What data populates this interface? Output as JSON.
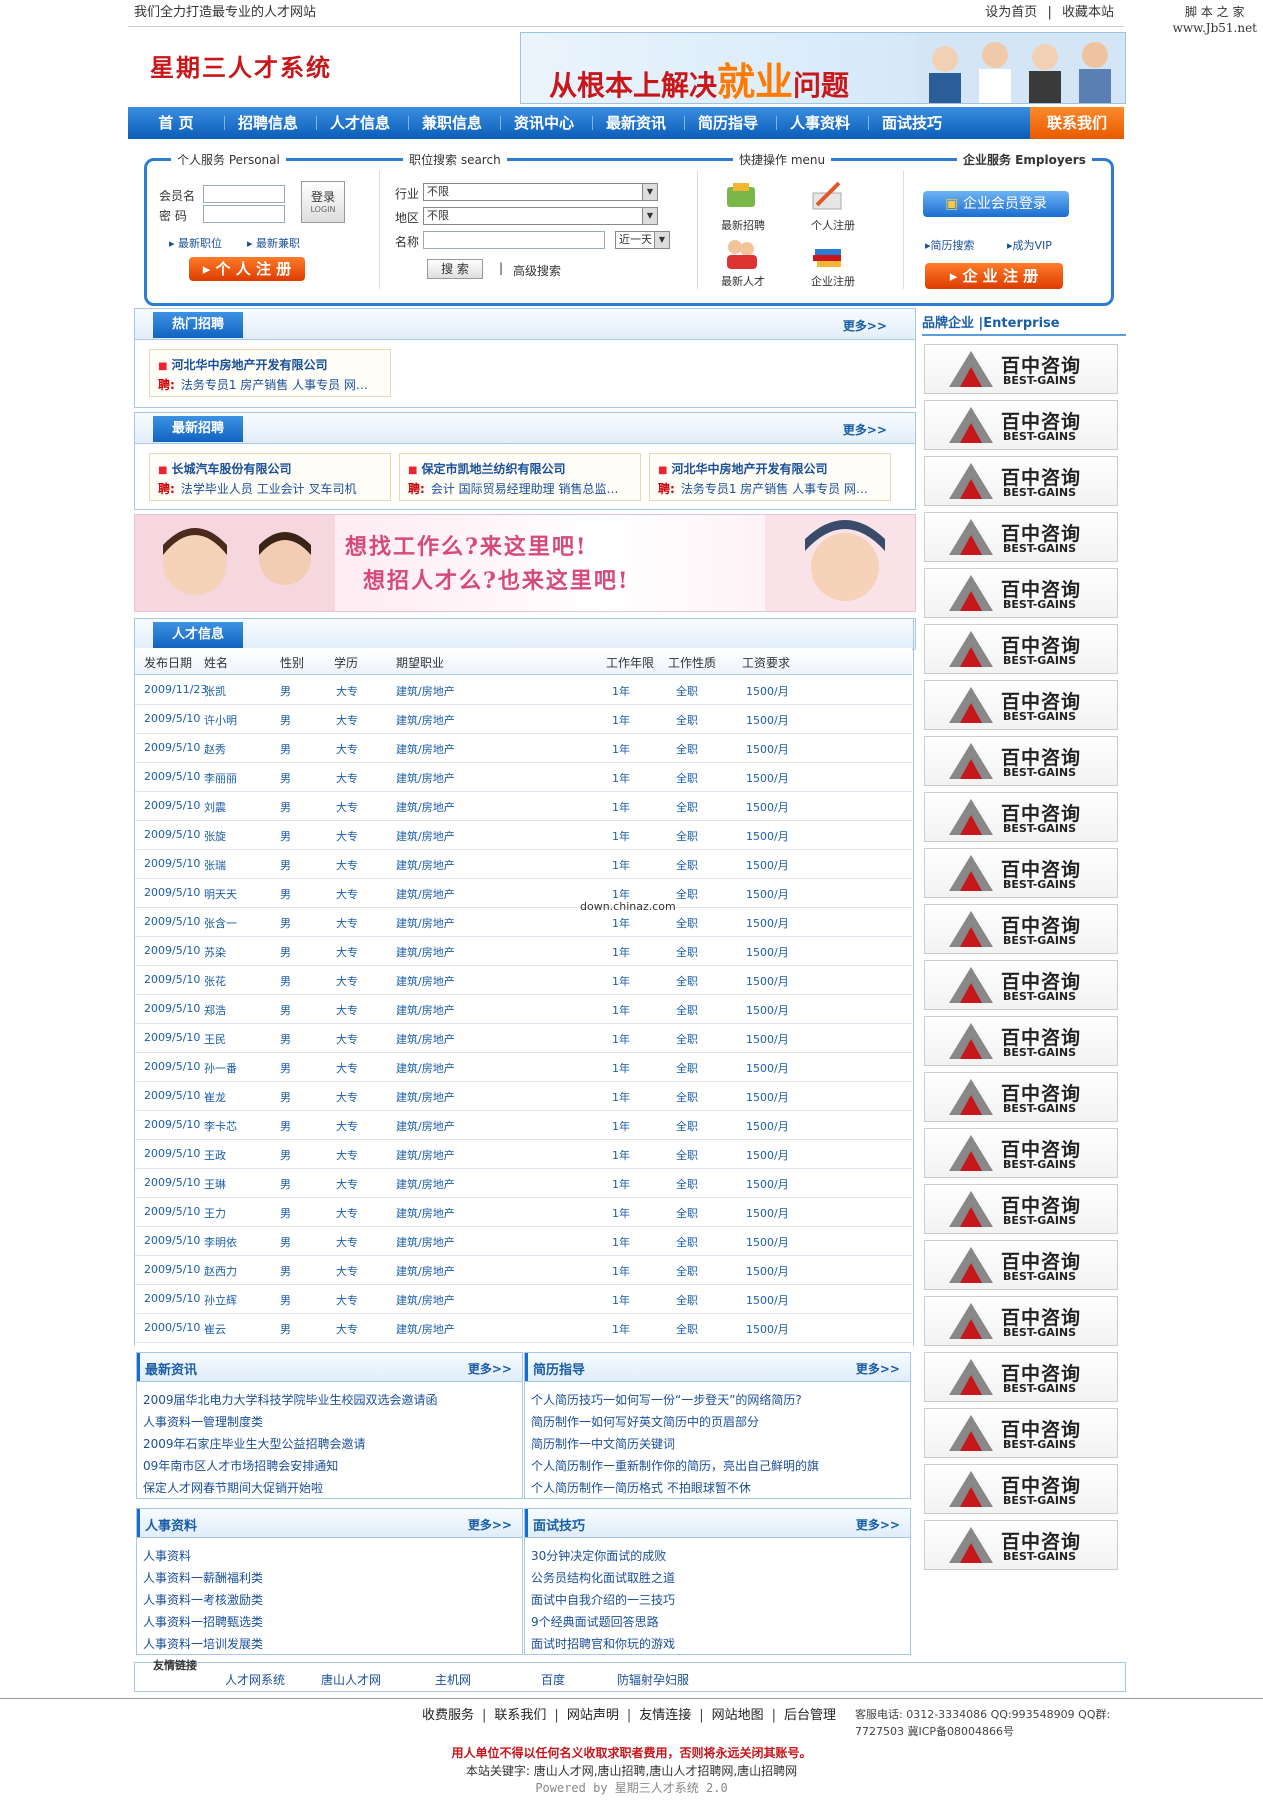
{
  "topbar": {
    "slogan": "我们全力打造最专业的人才网站",
    "set_home": "设为首页",
    "sep": "|",
    "bookmark": "收藏本站"
  },
  "watermark": {
    "line1": "脚 本 之 家",
    "line2": "www.Jb51.net"
  },
  "header": {
    "logo": "星期三人才系统",
    "banner_text": "从根本上解决",
    "banner_big": "就业",
    "banner_tail": "问题"
  },
  "nav": {
    "items": [
      "首 页",
      "招聘信息",
      "人才信息",
      "兼职信息",
      "资讯中心",
      "最新资讯",
      "简历指导",
      "人事资料",
      "面试技巧"
    ],
    "contact": "联系我们"
  },
  "personal": {
    "title": "个人服务 Personal",
    "member_label": "会员名",
    "password_label": "密 码",
    "login_btn": "登录",
    "login_sub": "LOGIN",
    "latest_jobs": "最新职位",
    "latest_part": "最新兼职",
    "register": "个 人 注 册"
  },
  "search": {
    "title": "职位搜索 search",
    "industry_label": "行业",
    "industry_value": "不限",
    "region_label": "地区",
    "region_value": "不限",
    "name_label": "名称",
    "time_value": "近一天",
    "search_btn": "搜 索",
    "sep": "|",
    "advanced": "高级搜索"
  },
  "quick": {
    "title": "快捷操作 menu",
    "items": [
      "最新招聘",
      "个人注册",
      "最新人才",
      "企业注册"
    ]
  },
  "employer": {
    "title": "企业服务 Employers",
    "login": "企业会员登录",
    "resume_search": "简历搜索",
    "vip": "成为VIP",
    "register": "企 业 注 册"
  },
  "hot": {
    "title": "热门招聘",
    "more": "更多>>",
    "cards": [
      {
        "company": "河北华中房地产开发有限公司",
        "tag": "聘:",
        "jobs": "法务专员1 房产销售 人事专员 网…"
      }
    ]
  },
  "latest": {
    "title": "最新招聘",
    "more": "更多>>",
    "cards": [
      {
        "company": "长城汽车股份有限公司",
        "tag": "聘:",
        "jobs": "法学毕业人员 工业会计 叉车司机"
      },
      {
        "company": "保定市凯地兰纺织有限公司",
        "tag": "聘:",
        "jobs": "会计 国际贸易经理助理 销售总监…"
      },
      {
        "company": "河北华中房地产开发有限公司",
        "tag": "聘:",
        "jobs": "法务专员1 房产销售 人事专员 网…"
      }
    ]
  },
  "ad": {
    "line1": "想找工作么?来这里吧!",
    "line2": "想招人才么?也来这里吧!"
  },
  "talent": {
    "title": "人才信息",
    "columns": [
      "发布日期",
      "姓名",
      "性别",
      "学历",
      "期望职业",
      "工作年限",
      "工作性质",
      "工资要求"
    ],
    "rows": [
      [
        "2009/11/23",
        "张凯",
        "男",
        "大专",
        "建筑/房地产",
        "1年",
        "全职",
        "1500/月"
      ],
      [
        "2009/5/10",
        "许小明",
        "男",
        "大专",
        "建筑/房地产",
        "1年",
        "全职",
        "1500/月"
      ],
      [
        "2009/5/10",
        "赵秀",
        "男",
        "大专",
        "建筑/房地产",
        "1年",
        "全职",
        "1500/月"
      ],
      [
        "2009/5/10",
        "李丽丽",
        "男",
        "大专",
        "建筑/房地产",
        "1年",
        "全职",
        "1500/月"
      ],
      [
        "2009/5/10",
        "刘震",
        "男",
        "大专",
        "建筑/房地产",
        "1年",
        "全职",
        "1500/月"
      ],
      [
        "2009/5/10",
        "张旋",
        "男",
        "大专",
        "建筑/房地产",
        "1年",
        "全职",
        "1500/月"
      ],
      [
        "2009/5/10",
        "张瑞",
        "男",
        "大专",
        "建筑/房地产",
        "1年",
        "全职",
        "1500/月"
      ],
      [
        "2009/5/10",
        "明天天",
        "男",
        "大专",
        "建筑/房地产",
        "1年",
        "全职",
        "1500/月"
      ],
      [
        "2009/5/10",
        "张含一",
        "男",
        "大专",
        "建筑/房地产",
        "1年",
        "全职",
        "1500/月"
      ],
      [
        "2009/5/10",
        "苏染",
        "男",
        "大专",
        "建筑/房地产",
        "1年",
        "全职",
        "1500/月"
      ],
      [
        "2009/5/10",
        "张花",
        "男",
        "大专",
        "建筑/房地产",
        "1年",
        "全职",
        "1500/月"
      ],
      [
        "2009/5/10",
        "郑浩",
        "男",
        "大专",
        "建筑/房地产",
        "1年",
        "全职",
        "1500/月"
      ],
      [
        "2009/5/10",
        "王民",
        "男",
        "大专",
        "建筑/房地产",
        "1年",
        "全职",
        "1500/月"
      ],
      [
        "2009/5/10",
        "孙一番",
        "男",
        "大专",
        "建筑/房地产",
        "1年",
        "全职",
        "1500/月"
      ],
      [
        "2009/5/10",
        "崔龙",
        "男",
        "大专",
        "建筑/房地产",
        "1年",
        "全职",
        "1500/月"
      ],
      [
        "2009/5/10",
        "李卡芯",
        "男",
        "大专",
        "建筑/房地产",
        "1年",
        "全职",
        "1500/月"
      ],
      [
        "2009/5/10",
        "王政",
        "男",
        "大专",
        "建筑/房地产",
        "1年",
        "全职",
        "1500/月"
      ],
      [
        "2009/5/10",
        "王琳",
        "男",
        "大专",
        "建筑/房地产",
        "1年",
        "全职",
        "1500/月"
      ],
      [
        "2009/5/10",
        "王力",
        "男",
        "大专",
        "建筑/房地产",
        "1年",
        "全职",
        "1500/月"
      ],
      [
        "2009/5/10",
        "李明依",
        "男",
        "大专",
        "建筑/房地产",
        "1年",
        "全职",
        "1500/月"
      ],
      [
        "2009/5/10",
        "赵西力",
        "男",
        "大专",
        "建筑/房地产",
        "1年",
        "全职",
        "1500/月"
      ],
      [
        "2009/5/10",
        "孙立辉",
        "男",
        "大专",
        "建筑/房地产",
        "1年",
        "全职",
        "1500/月"
      ],
      [
        "2000/5/10",
        "崔云",
        "男",
        "大专",
        "建筑/房地产",
        "1年",
        "全职",
        "1500/月"
      ]
    ]
  },
  "overlay_note": "down.chinaz.com",
  "news": {
    "title": "最新资讯",
    "more": "更多>>",
    "items": [
      "2009届华北电力大学科技学院毕业生校园双选会邀请函",
      "人事资料一管理制度类",
      "2009年石家庄毕业生大型公益招聘会邀请",
      "09年南市区人才市场招聘会安排通知",
      "保定人才网春节期间大促销开始啦"
    ]
  },
  "resume": {
    "title": "简历指导",
    "more": "更多>>",
    "items": [
      "个人简历技巧一如何写一份“一步登天”的网络简历?",
      "简历制作一如何写好英文简历中的页眉部分",
      "简历制作一中文简历关键词",
      "个人简历制作一重新制作你的简历，亮出自己鲜明的旗",
      "个人简历制作一简历格式 不拍眼球暂不休"
    ]
  },
  "hr": {
    "title": "人事资料",
    "more": "更多>>",
    "items": [
      "人事资料",
      "人事资料一薪酬福利类",
      "人事资料一考核激励类",
      "人事资料一招聘甄选类",
      "人事资料一培训发展类"
    ]
  },
  "interview": {
    "title": "面试技巧",
    "more": "更多>>",
    "items": [
      "30分钟决定你面试的成败",
      "公务员结构化面试取胜之道",
      "面试中自我介绍的一三技巧",
      "9个经典面试题回答思路",
      "面试时招聘官和你玩的游戏"
    ]
  },
  "brand": {
    "title": "品牌企业 |Enterprise",
    "logo_cn": "百中咨询",
    "logo_en": "BEST-GAINS",
    "count": 22
  },
  "friend_links": {
    "title": "友情链接",
    "items": [
      "人才网系统",
      "唐山人才网",
      "主机网",
      "百度",
      "防辐射孕妇服"
    ]
  },
  "footer": {
    "nav": [
      "收费服务",
      "联系我们",
      "网站声明",
      "友情连接",
      "网站地图",
      "后台管理"
    ],
    "sep": "|",
    "contact": "客服电话: 0312-3334086 QQ:993548909 QQ群: 7727503 冀ICP备08004866号",
    "warning": "用人单位不得以任何名义收取求职者费用，否则将永远关闭其账号。",
    "keywords": "本站关键字: 唐山人才网,唐山招聘,唐山人才招聘网,唐山招聘网",
    "powered": "Powered by 星期三人才系统 2.0"
  },
  "colors": {
    "nav_blue": "#0b5db8",
    "accent_orange": "#e85a00",
    "brand_red": "#c8171b",
    "link_blue": "#1a4f9a"
  }
}
